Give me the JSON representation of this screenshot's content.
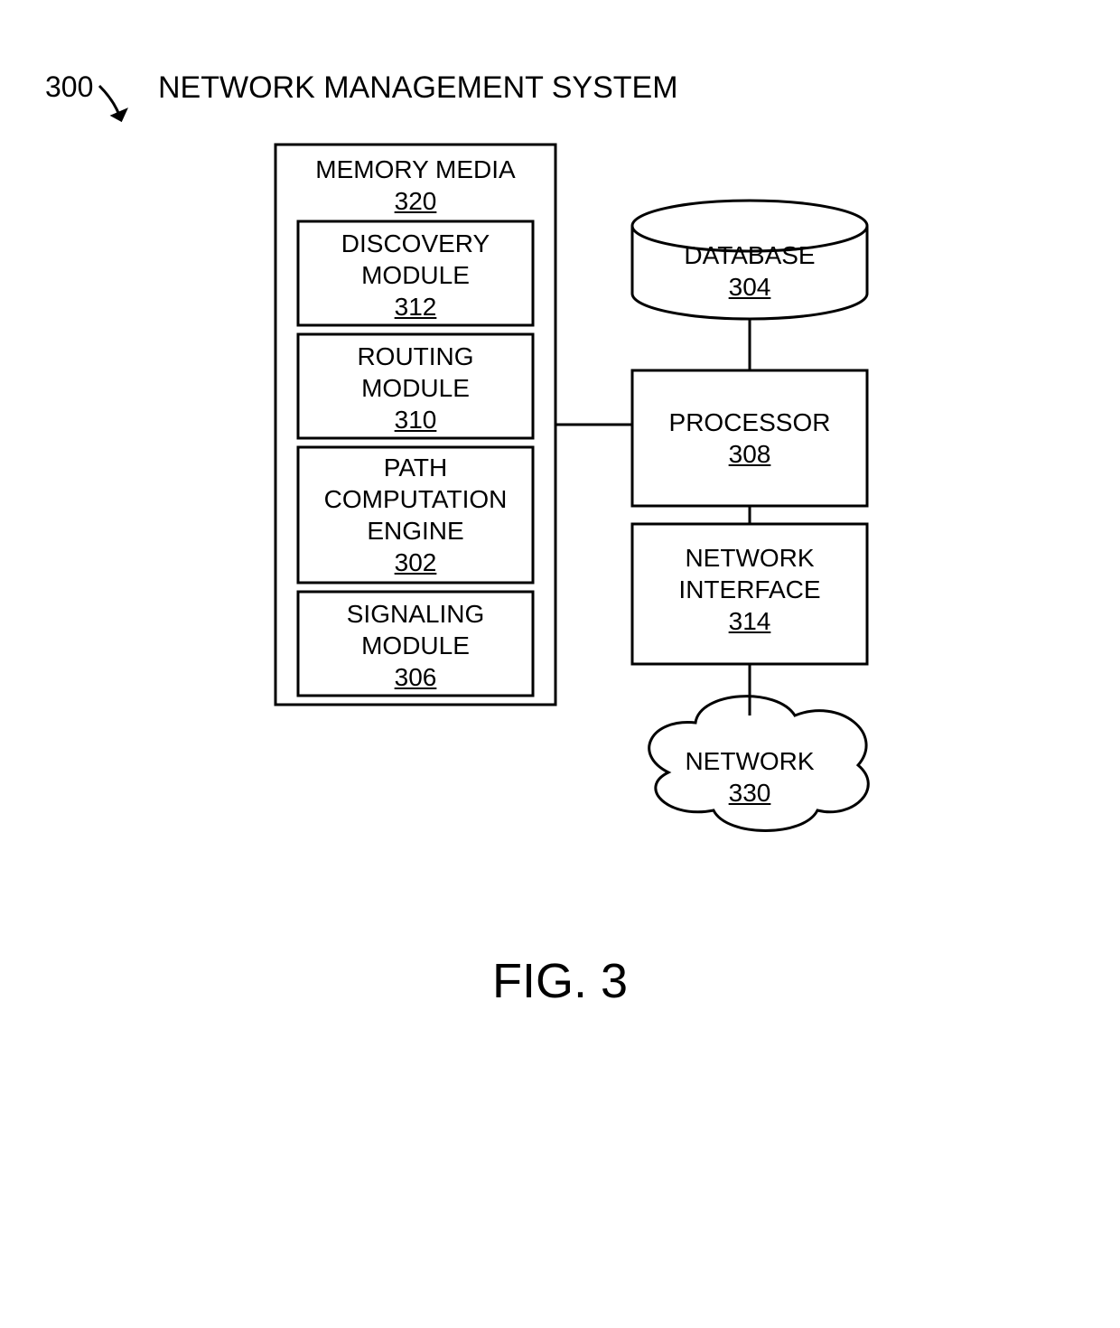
{
  "header": {
    "ref": "300",
    "title": "NETWORK MANAGEMENT SYSTEM"
  },
  "memory": {
    "title": "MEMORY MEDIA",
    "num": "320",
    "modules": {
      "discovery": {
        "l1": "DISCOVERY",
        "l2": "MODULE",
        "num": "312"
      },
      "routing": {
        "l1": "ROUTING",
        "l2": "MODULE",
        "num": "310"
      },
      "pce": {
        "l1": "PATH",
        "l2": "COMPUTATION",
        "l3": "ENGINE",
        "num": "302"
      },
      "signaling": {
        "l1": "SIGNALING",
        "l2": "MODULE",
        "num": "306"
      }
    }
  },
  "database": {
    "title": "DATABASE",
    "num": "304"
  },
  "processor": {
    "title": "PROCESSOR",
    "num": "308"
  },
  "nic": {
    "l1": "NETWORK",
    "l2": "INTERFACE",
    "num": "314"
  },
  "network": {
    "title": "NETWORK",
    "num": "330"
  },
  "figure": {
    "caption": "FIG. 3"
  }
}
